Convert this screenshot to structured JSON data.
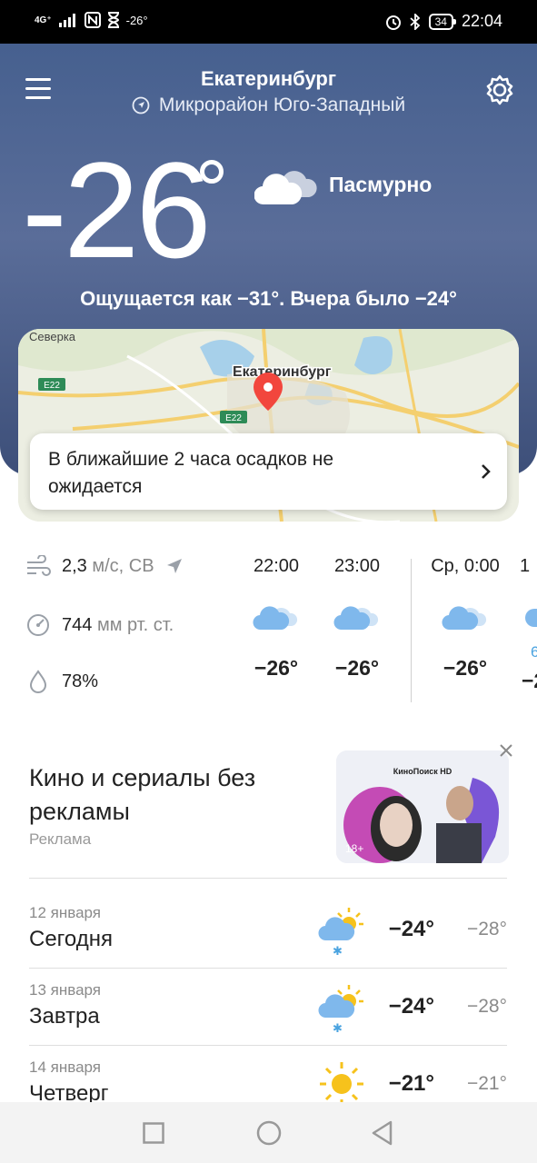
{
  "status_bar": {
    "network": "4G⁺",
    "temp_indicator": "-26°",
    "battery": "34",
    "time": "22:04"
  },
  "location": {
    "city": "Екатеринбург",
    "district": "Микрорайон Юго-Западный"
  },
  "current": {
    "temperature": "-26",
    "condition": "Пасмурно",
    "feels_like": "Ощущается как −31°. Вчера было −24°"
  },
  "map": {
    "labels": {
      "city": "Екатеринбург",
      "village": "Северка",
      "road1": "E22",
      "road2": "E22"
    }
  },
  "precipitation": {
    "text": "В ближайшие 2 часа осадков не ожидается"
  },
  "details": {
    "wind_value": "2,3",
    "wind_unit": "м/с, СВ",
    "pressure_value": "744",
    "pressure_unit": "мм рт. ст.",
    "humidity_value": "78%"
  },
  "hourly": [
    {
      "time": "22:00",
      "temp": "−26°"
    },
    {
      "time": "23:00",
      "temp": "−26°"
    },
    {
      "time": "Ср, 0:00",
      "temp": "−26°"
    },
    {
      "time": "1",
      "temp": "−2",
      "extra": "6"
    }
  ],
  "ad": {
    "title": "Кино и сериалы без рекламы",
    "label": "Реклама",
    "brand": "КиноПоиск HD",
    "age": "18+"
  },
  "daily": [
    {
      "date": "12 января",
      "name": "Сегодня",
      "hi": "−24°",
      "lo": "−28°",
      "icon": "partly-cloudy-snow-icon"
    },
    {
      "date": "13 января",
      "name": "Завтра",
      "hi": "−24°",
      "lo": "−28°",
      "icon": "partly-cloudy-snow-icon"
    },
    {
      "date": "14 января",
      "name": "Четверг",
      "hi": "−21°",
      "lo": "−21°",
      "icon": "sun-icon"
    }
  ],
  "colors": {
    "hero_top": "#46608f",
    "hero_bottom": "#3d4f79",
    "pin": "#f2463d",
    "accent_blue": "#4aa3e0"
  }
}
